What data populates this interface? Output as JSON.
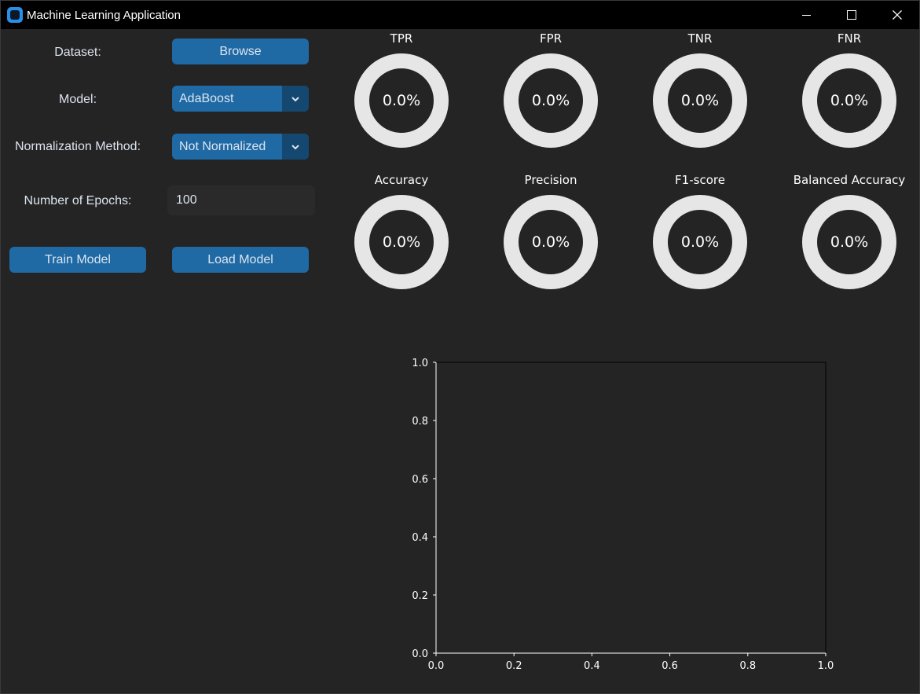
{
  "window": {
    "title": "Machine Learning Application"
  },
  "controls": {
    "dataset_label": "Dataset:",
    "browse_label": "Browse",
    "model_label": "Model:",
    "model_value": "AdaBoost",
    "normalization_label": "Normalization Method:",
    "normalization_value": "Not Normalized",
    "epochs_label": "Number of Epochs:",
    "epochs_value": "100",
    "train_label": "Train Model",
    "load_label": "Load Model"
  },
  "metrics": [
    {
      "title": "TPR",
      "value": "0.0%"
    },
    {
      "title": "FPR",
      "value": "0.0%"
    },
    {
      "title": "TNR",
      "value": "0.0%"
    },
    {
      "title": "FNR",
      "value": "0.0%"
    },
    {
      "title": "Accuracy",
      "value": "0.0%"
    },
    {
      "title": "Precision",
      "value": "0.0%"
    },
    {
      "title": "F1-score",
      "value": "0.0%"
    },
    {
      "title": "Balanced Accuracy",
      "value": "0.0%"
    }
  ],
  "colors": {
    "background": "#242424",
    "titlebar": "#000000",
    "button": "#1f6aa5",
    "button_dark": "#144870",
    "ring": "#e6e6e6"
  },
  "chart_data": {
    "type": "scatter",
    "series": [],
    "xlim": [
      0.0,
      1.0
    ],
    "ylim": [
      0.0,
      1.0
    ],
    "x_ticks": [
      "0.0",
      "0.2",
      "0.4",
      "0.6",
      "0.8",
      "1.0"
    ],
    "y_ticks": [
      "0.0",
      "0.2",
      "0.4",
      "0.6",
      "0.8",
      "1.0"
    ],
    "title": "",
    "xlabel": "",
    "ylabel": "",
    "grid": false
  }
}
